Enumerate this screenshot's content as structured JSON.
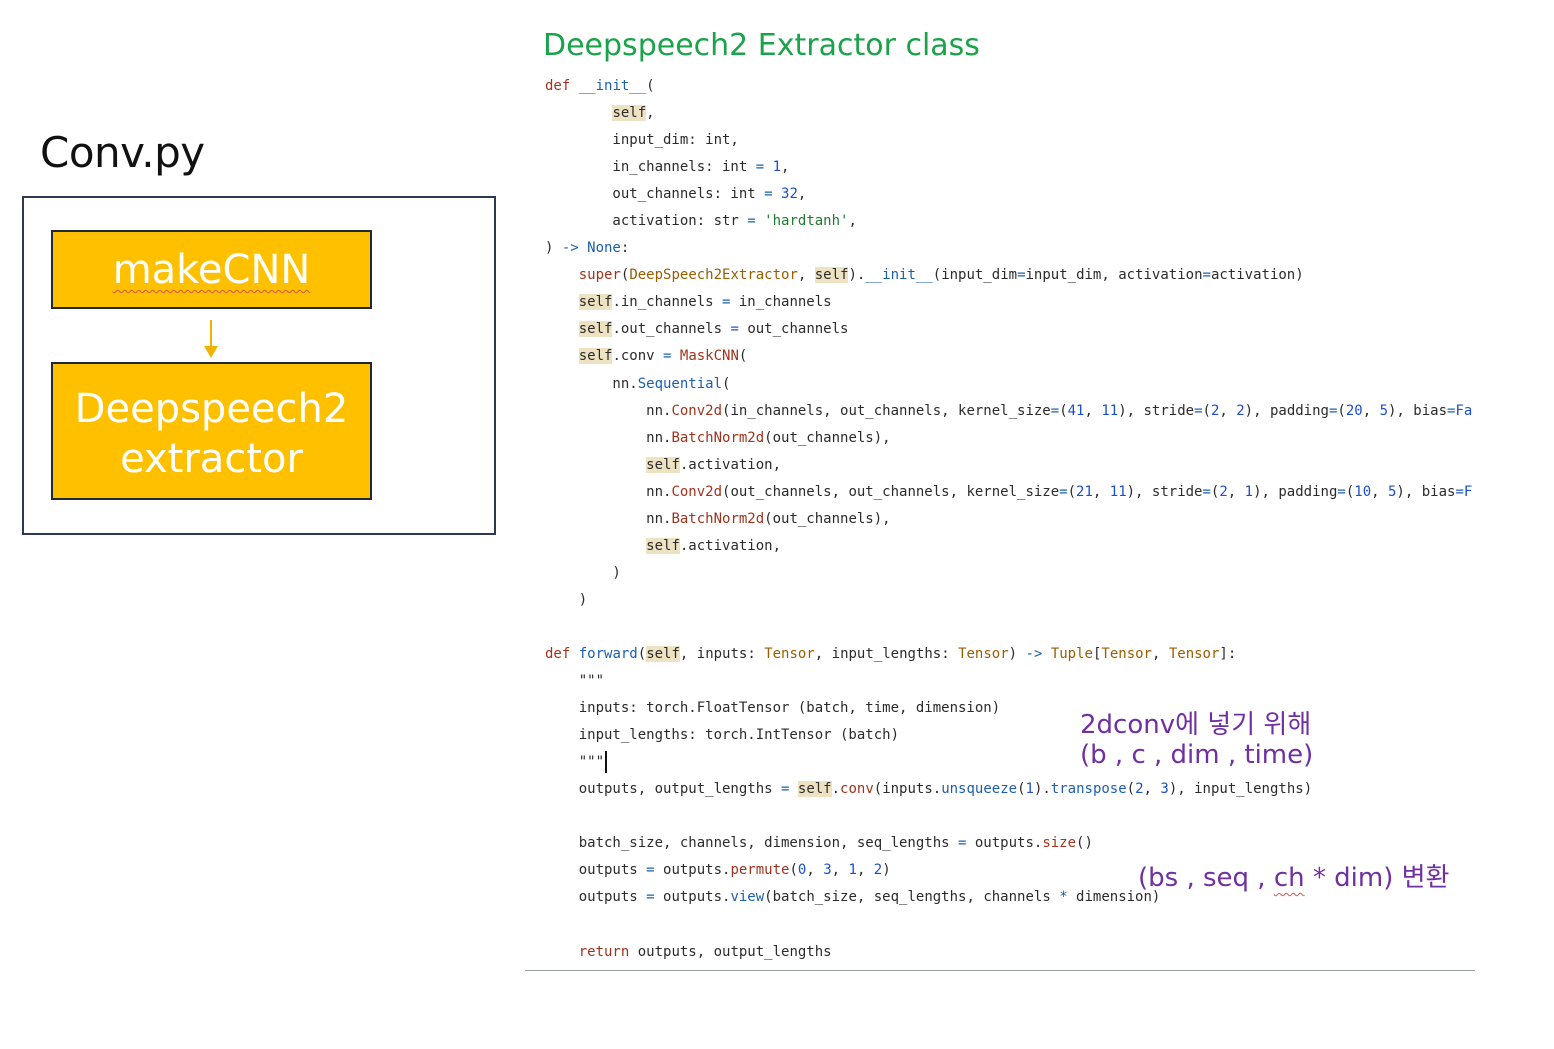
{
  "left_panel": {
    "title": "Conv.py",
    "box_top": "makeCNN",
    "box_bottom_line1": "Deepspeech2",
    "box_bottom_line2": "extractor"
  },
  "code_panel": {
    "title": "Deepspeech2 Extractor class"
  },
  "notes": {
    "note1": "2dconv에 넣기 위해",
    "note2": "(b , c , dim , time)",
    "note3_a": "(bs , seq , ",
    "note3_b": "ch",
    "note3_c": " * dim) 변환"
  },
  "colors": {
    "box_fill": "#ffc000",
    "title_green": "#1aa34a",
    "note_purple": "#7030a0"
  }
}
